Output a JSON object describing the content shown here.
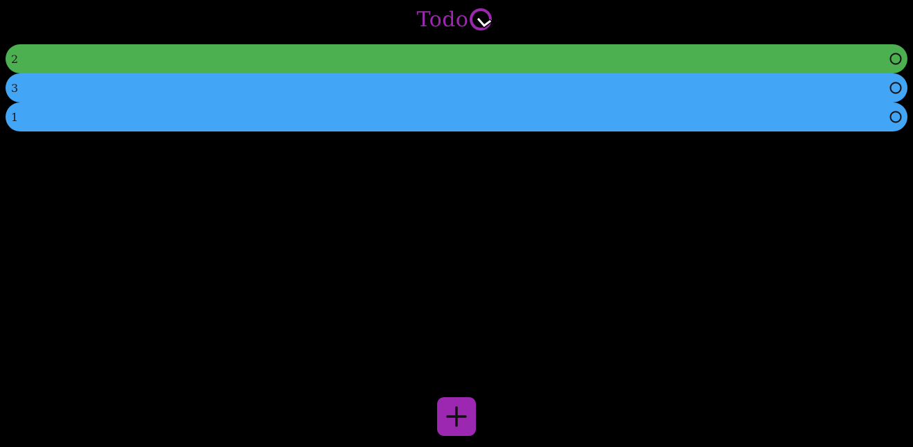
{
  "header": {
    "title": "Todo",
    "logo_icon": "circle-check-logo-icon",
    "color": "#9c27b0"
  },
  "todos": [
    {
      "label": "2",
      "color": "#4caf50",
      "check_icon": "circle-outline-icon"
    },
    {
      "label": "3",
      "color": "#42a5f5",
      "check_icon": "circle-outline-icon"
    },
    {
      "label": "1",
      "color": "#42a5f5",
      "check_icon": "circle-outline-icon"
    }
  ],
  "fab": {
    "icon": "plus-icon",
    "color": "#9c27b0"
  },
  "theme": {
    "background": "#000000"
  }
}
